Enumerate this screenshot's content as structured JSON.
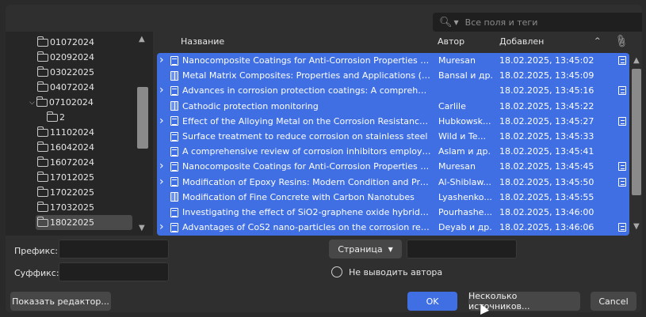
{
  "search": {
    "placeholder": "Все поля и теги",
    "icon": "search-icon"
  },
  "tree": {
    "items": [
      {
        "label": "01072024"
      },
      {
        "label": "02092024"
      },
      {
        "label": "03022025"
      },
      {
        "label": "04072024"
      },
      {
        "label": "07102024",
        "expanded": true
      },
      {
        "label": "2",
        "child": true
      },
      {
        "label": "11102024"
      },
      {
        "label": "16042024"
      },
      {
        "label": "16072024"
      },
      {
        "label": "17012025"
      },
      {
        "label": "17022025"
      },
      {
        "label": "17032025"
      },
      {
        "label": "18022025",
        "selected": true
      }
    ]
  },
  "table": {
    "headers": {
      "title": "Название",
      "author": "Автор",
      "added": "Добавлен",
      "sort": "^"
    },
    "rows": [
      {
        "expander": true,
        "icon": "doc",
        "title": "Nanocomposite Coatings for Anti-Corrosion Properties of...",
        "author": "Muresan",
        "added": "18.02.2025, 13:45:02",
        "attachment": true
      },
      {
        "expander": false,
        "icon": "book",
        "title": "Metal Matrix Composites: Properties and Applications (Vo...",
        "author": "Bansal и др.",
        "added": "18.02.2025, 13:45:09",
        "attachment": false
      },
      {
        "expander": true,
        "icon": "doc",
        "title": "Advances in corrosion protection coatings: A comprehens...",
        "author": "",
        "added": "18.02.2025, 13:45:16",
        "attachment": true
      },
      {
        "expander": false,
        "icon": "book",
        "title": "Cathodic protection monitoring",
        "author": "Carlile",
        "added": "18.02.2025, 13:45:22",
        "attachment": false
      },
      {
        "expander": true,
        "icon": "doc",
        "title": "Effect of the Alloying Metal on the Corrosion Resistance o...",
        "author": "Hubkowsk...",
        "added": "18.02.2025, 13:45:27",
        "attachment": true
      },
      {
        "expander": false,
        "icon": "doc",
        "title": "Surface treatment to reduce corrosion on stainless steel",
        "author": "Wild и Te...",
        "added": "18.02.2025, 13:45:33",
        "attachment": false
      },
      {
        "expander": false,
        "icon": "doc",
        "title": "A comprehensive review of corrosion inhibitors employed...",
        "author": "Aslam и др.",
        "added": "18.02.2025, 13:45:41",
        "attachment": false
      },
      {
        "expander": true,
        "icon": "doc",
        "title": "Nanocomposite Coatings for Anti-Corrosion Properties of...",
        "author": "Muresan",
        "added": "18.02.2025, 13:45:45",
        "attachment": true
      },
      {
        "expander": true,
        "icon": "doc",
        "title": "Modification of Epoxy Resins: Modern Condition and Pros...",
        "author": "Al-Shiblaw...",
        "added": "18.02.2025, 13:45:50",
        "attachment": true
      },
      {
        "expander": false,
        "icon": "book",
        "title": "Modification of Fine Concrete with Carbon Nanotubes",
        "author": "Lyashenko...",
        "added": "18.02.2025, 13:45:55",
        "attachment": false
      },
      {
        "expander": false,
        "icon": "doc",
        "title": "Investigating the effect of SiO2-graphene oxide hybrid as ...",
        "author": "Pourhashe...",
        "added": "18.02.2025, 13:46:00",
        "attachment": false
      },
      {
        "expander": true,
        "icon": "doc",
        "title": "Advantages of CoS2 nano-particles on the corrosion resis...",
        "author": "Deyab и др.",
        "added": "18.02.2025, 13:46:06",
        "attachment": true
      }
    ]
  },
  "form": {
    "prefix_label": "Префикс:",
    "suffix_label": "Суффикс:",
    "prefix_value": "",
    "suffix_value": "",
    "page_button": "Страница",
    "page_value": "",
    "omit_author_label": "Не выводить автора"
  },
  "buttons": {
    "show_editor": "Показать редактор...",
    "ok": "OK",
    "multiple_sources": "Несколько источников...",
    "cancel": "Cancel"
  },
  "colors": {
    "accent": "#3f6fe2",
    "background": "#2f2f2f"
  }
}
